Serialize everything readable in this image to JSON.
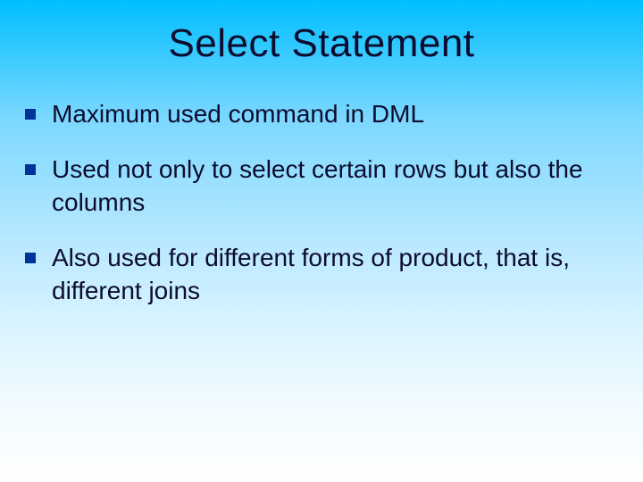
{
  "title": "Select Statement",
  "bullets": [
    "Maximum used command in DML",
    "Used not only to select certain rows but also the columns",
    "Also used for different forms of product, that is, different joins"
  ]
}
